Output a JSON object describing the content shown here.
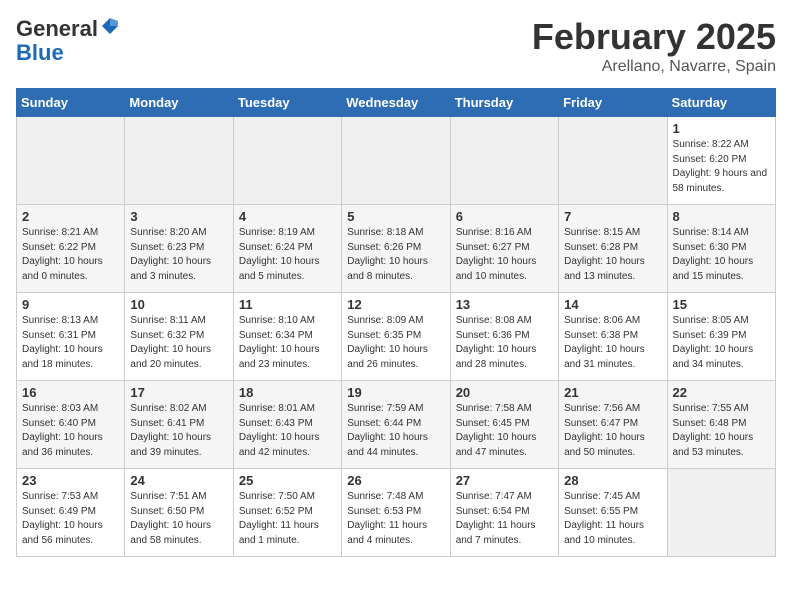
{
  "header": {
    "logo_general": "General",
    "logo_blue": "Blue",
    "title": "February 2025",
    "location": "Arellano, Navarre, Spain"
  },
  "days_of_week": [
    "Sunday",
    "Monday",
    "Tuesday",
    "Wednesday",
    "Thursday",
    "Friday",
    "Saturday"
  ],
  "weeks": [
    [
      {
        "num": "",
        "info": ""
      },
      {
        "num": "",
        "info": ""
      },
      {
        "num": "",
        "info": ""
      },
      {
        "num": "",
        "info": ""
      },
      {
        "num": "",
        "info": ""
      },
      {
        "num": "",
        "info": ""
      },
      {
        "num": "1",
        "info": "Sunrise: 8:22 AM\nSunset: 6:20 PM\nDaylight: 9 hours and 58 minutes."
      }
    ],
    [
      {
        "num": "2",
        "info": "Sunrise: 8:21 AM\nSunset: 6:22 PM\nDaylight: 10 hours and 0 minutes."
      },
      {
        "num": "3",
        "info": "Sunrise: 8:20 AM\nSunset: 6:23 PM\nDaylight: 10 hours and 3 minutes."
      },
      {
        "num": "4",
        "info": "Sunrise: 8:19 AM\nSunset: 6:24 PM\nDaylight: 10 hours and 5 minutes."
      },
      {
        "num": "5",
        "info": "Sunrise: 8:18 AM\nSunset: 6:26 PM\nDaylight: 10 hours and 8 minutes."
      },
      {
        "num": "6",
        "info": "Sunrise: 8:16 AM\nSunset: 6:27 PM\nDaylight: 10 hours and 10 minutes."
      },
      {
        "num": "7",
        "info": "Sunrise: 8:15 AM\nSunset: 6:28 PM\nDaylight: 10 hours and 13 minutes."
      },
      {
        "num": "8",
        "info": "Sunrise: 8:14 AM\nSunset: 6:30 PM\nDaylight: 10 hours and 15 minutes."
      }
    ],
    [
      {
        "num": "9",
        "info": "Sunrise: 8:13 AM\nSunset: 6:31 PM\nDaylight: 10 hours and 18 minutes."
      },
      {
        "num": "10",
        "info": "Sunrise: 8:11 AM\nSunset: 6:32 PM\nDaylight: 10 hours and 20 minutes."
      },
      {
        "num": "11",
        "info": "Sunrise: 8:10 AM\nSunset: 6:34 PM\nDaylight: 10 hours and 23 minutes."
      },
      {
        "num": "12",
        "info": "Sunrise: 8:09 AM\nSunset: 6:35 PM\nDaylight: 10 hours and 26 minutes."
      },
      {
        "num": "13",
        "info": "Sunrise: 8:08 AM\nSunset: 6:36 PM\nDaylight: 10 hours and 28 minutes."
      },
      {
        "num": "14",
        "info": "Sunrise: 8:06 AM\nSunset: 6:38 PM\nDaylight: 10 hours and 31 minutes."
      },
      {
        "num": "15",
        "info": "Sunrise: 8:05 AM\nSunset: 6:39 PM\nDaylight: 10 hours and 34 minutes."
      }
    ],
    [
      {
        "num": "16",
        "info": "Sunrise: 8:03 AM\nSunset: 6:40 PM\nDaylight: 10 hours and 36 minutes."
      },
      {
        "num": "17",
        "info": "Sunrise: 8:02 AM\nSunset: 6:41 PM\nDaylight: 10 hours and 39 minutes."
      },
      {
        "num": "18",
        "info": "Sunrise: 8:01 AM\nSunset: 6:43 PM\nDaylight: 10 hours and 42 minutes."
      },
      {
        "num": "19",
        "info": "Sunrise: 7:59 AM\nSunset: 6:44 PM\nDaylight: 10 hours and 44 minutes."
      },
      {
        "num": "20",
        "info": "Sunrise: 7:58 AM\nSunset: 6:45 PM\nDaylight: 10 hours and 47 minutes."
      },
      {
        "num": "21",
        "info": "Sunrise: 7:56 AM\nSunset: 6:47 PM\nDaylight: 10 hours and 50 minutes."
      },
      {
        "num": "22",
        "info": "Sunrise: 7:55 AM\nSunset: 6:48 PM\nDaylight: 10 hours and 53 minutes."
      }
    ],
    [
      {
        "num": "23",
        "info": "Sunrise: 7:53 AM\nSunset: 6:49 PM\nDaylight: 10 hours and 56 minutes."
      },
      {
        "num": "24",
        "info": "Sunrise: 7:51 AM\nSunset: 6:50 PM\nDaylight: 10 hours and 58 minutes."
      },
      {
        "num": "25",
        "info": "Sunrise: 7:50 AM\nSunset: 6:52 PM\nDaylight: 11 hours and 1 minute."
      },
      {
        "num": "26",
        "info": "Sunrise: 7:48 AM\nSunset: 6:53 PM\nDaylight: 11 hours and 4 minutes."
      },
      {
        "num": "27",
        "info": "Sunrise: 7:47 AM\nSunset: 6:54 PM\nDaylight: 11 hours and 7 minutes."
      },
      {
        "num": "28",
        "info": "Sunrise: 7:45 AM\nSunset: 6:55 PM\nDaylight: 11 hours and 10 minutes."
      },
      {
        "num": "",
        "info": ""
      }
    ]
  ]
}
